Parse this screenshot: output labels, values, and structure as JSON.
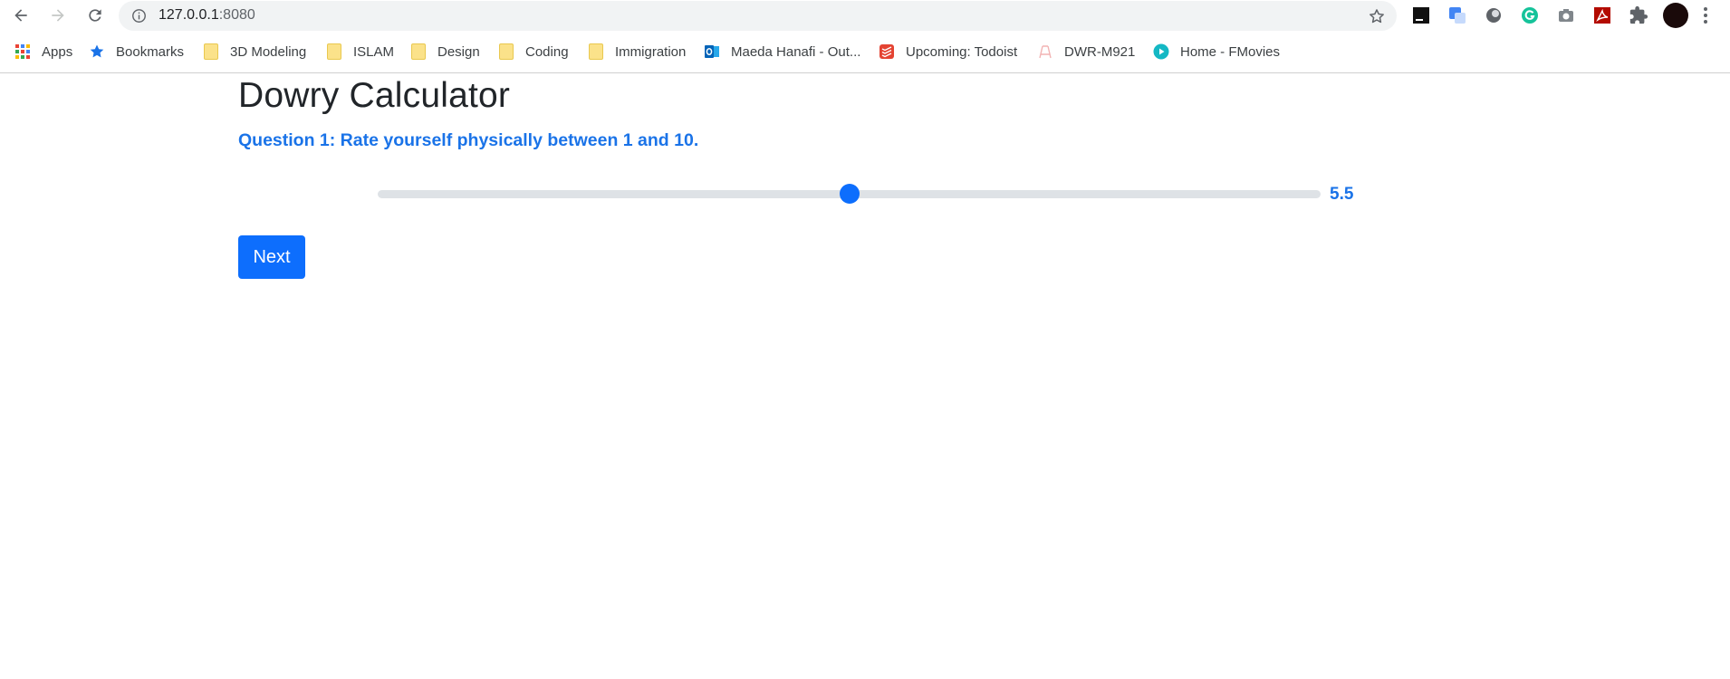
{
  "browser": {
    "url_host": "127.0.0.1",
    "url_port": ":8080",
    "nav": [
      "back-icon",
      "forward-icon",
      "reload-icon"
    ],
    "extensions": [
      "jetbrains-icon",
      "google-translate-icon",
      "circle-extension-icon",
      "grammarly-icon",
      "camera-icon",
      "acrobat-icon",
      "puzzle-icon"
    ]
  },
  "bookmarks": {
    "items": [
      {
        "label": "Apps",
        "icon": "apps-grid-icon"
      },
      {
        "label": "Bookmarks",
        "icon": "star-icon"
      },
      {
        "label": "3D Modeling",
        "icon": "folder-icon"
      },
      {
        "label": "ISLAM",
        "icon": "folder-icon"
      },
      {
        "label": "Design",
        "icon": "folder-icon"
      },
      {
        "label": "Coding",
        "icon": "folder-icon"
      },
      {
        "label": "Immigration",
        "icon": "folder-icon"
      },
      {
        "label": "Maeda Hanafi - Out...",
        "icon": "outlook-icon"
      },
      {
        "label": "Upcoming: Todoist",
        "icon": "todoist-icon"
      },
      {
        "label": "DWR-M921",
        "icon": "router-icon"
      },
      {
        "label": "Home - FMovies",
        "icon": "play-icon"
      }
    ]
  },
  "page": {
    "title": "Dowry Calculator",
    "question": "Question 1: Rate yourself physically between 1 and 10.",
    "slider": {
      "min": 1,
      "max": 10,
      "value": 5.5,
      "value_label": "5.5"
    },
    "next_label": "Next"
  },
  "colors": {
    "accent": "#0d6efd",
    "question_text": "#1a73e8",
    "slider_track": "#dee2e6"
  }
}
